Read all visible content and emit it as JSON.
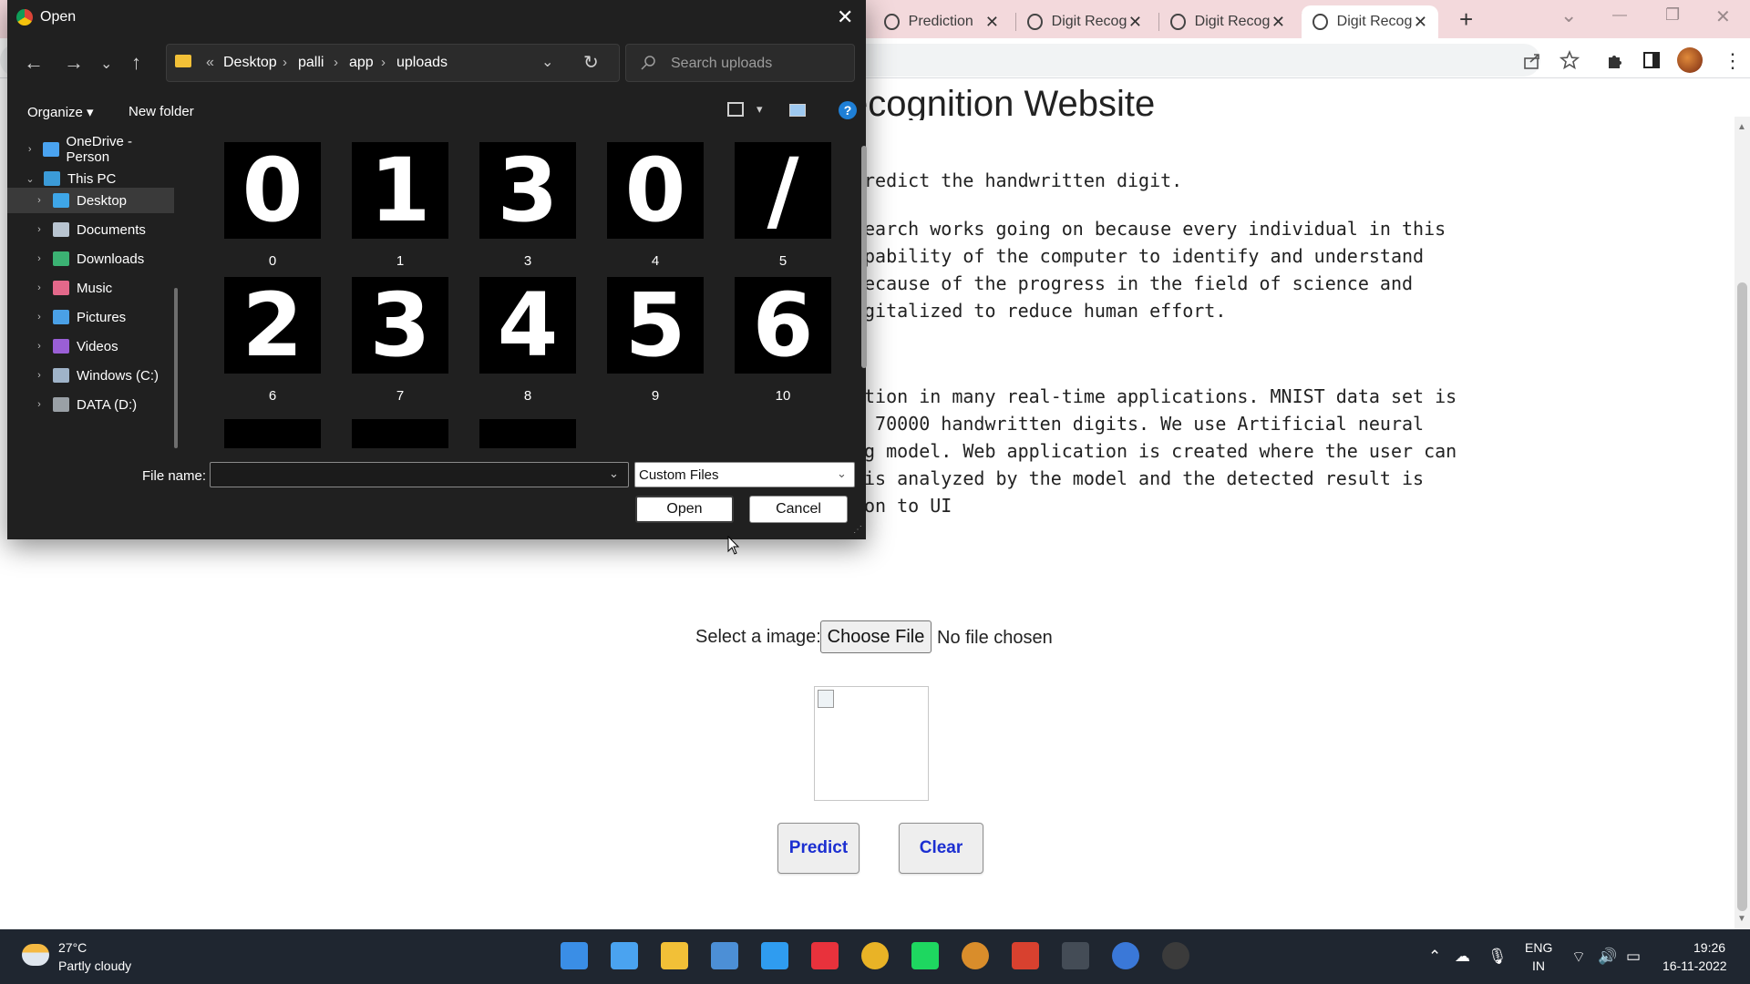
{
  "browser": {
    "tabs": [
      {
        "label": "Prediction",
        "active": false
      },
      {
        "label": "Digit Recog",
        "active": false
      },
      {
        "label": "Digit Recog",
        "active": false
      },
      {
        "label": "Digit Recog",
        "active": true
      }
    ],
    "new_tab_glyph": "+",
    "window_controls": {
      "minimize": "—",
      "maximize": "❐",
      "close": "✕",
      "dropdown": "⌄"
    },
    "toolbar_icons": [
      "share-icon",
      "star-icon",
      "extensions-icon",
      "sidepanel-icon",
      "profile-avatar",
      "menu-icon"
    ]
  },
  "page": {
    "heading": "ecognition Website",
    "intro": "redict the handwritten digit.",
    "paragraph1": [
      "earch works going on because every individual in this",
      "pability of the computer to identify and understand",
      "ecause of the progress in the field of science and",
      "gitalized to reduce human effort."
    ],
    "paragraph2": [
      "tion in many real-time applications. MNIST data set is",
      " 70000 handwritten digits. We use Artificial neural",
      "g model. Web application is created where the user can",
      "is analyzed by the model and the detected result is",
      "on to UI"
    ],
    "form": {
      "label": "Select a image:",
      "choose_file": "Choose File",
      "no_file": "No file chosen",
      "predict": "Predict",
      "clear": "Clear"
    }
  },
  "dialog": {
    "title": "Open",
    "close": "✕",
    "path": [
      "«",
      "Desktop",
      "palli",
      "app",
      "uploads"
    ],
    "search_placeholder": "Search uploads",
    "organize": "Organize ▾",
    "new_folder": "New folder",
    "nav_items": [
      {
        "label": "OneDrive - Person",
        "icon": "onedrive-icon",
        "color": "#4aa3f0",
        "indent": 0,
        "expand": "›",
        "selected": false
      },
      {
        "label": "This PC",
        "icon": "pc-icon",
        "color": "#3b9bd8",
        "indent": 0,
        "expand": "⌄",
        "selected": false
      },
      {
        "label": "Desktop",
        "icon": "desktop-icon",
        "color": "#3ea6e8",
        "indent": 1,
        "expand": "›",
        "selected": true
      },
      {
        "label": "Documents",
        "icon": "documents-icon",
        "color": "#b8c4d0",
        "indent": 1,
        "expand": "›",
        "selected": false
      },
      {
        "label": "Downloads",
        "icon": "downloads-icon",
        "color": "#3bb273",
        "indent": 1,
        "expand": "›",
        "selected": false
      },
      {
        "label": "Music",
        "icon": "music-icon",
        "color": "#e3688a",
        "indent": 1,
        "expand": "›",
        "selected": false
      },
      {
        "label": "Pictures",
        "icon": "pictures-icon",
        "color": "#4aa0e6",
        "indent": 1,
        "expand": "›",
        "selected": false
      },
      {
        "label": "Videos",
        "icon": "videos-icon",
        "color": "#9a5fd6",
        "indent": 1,
        "expand": "›",
        "selected": false
      },
      {
        "label": "Windows (C:)",
        "icon": "drive-icon",
        "color": "#9fb3c8",
        "indent": 1,
        "expand": "›",
        "selected": false
      },
      {
        "label": "DATA (D:)",
        "icon": "drive-icon",
        "color": "#9aa0a6",
        "indent": 1,
        "expand": "›",
        "selected": false
      }
    ],
    "files": [
      {
        "name": "0",
        "digit": "0"
      },
      {
        "name": "1",
        "digit": "1"
      },
      {
        "name": "3",
        "digit": "3"
      },
      {
        "name": "4",
        "digit": "0"
      },
      {
        "name": "5",
        "digit": "/"
      },
      {
        "name": "6",
        "digit": "2"
      },
      {
        "name": "7",
        "digit": "3"
      },
      {
        "name": "8",
        "digit": "4"
      },
      {
        "name": "9",
        "digit": "5"
      },
      {
        "name": "10",
        "digit": "6"
      }
    ],
    "file_name_label": "File name:",
    "file_name_value": "",
    "file_type": "Custom Files",
    "open_button": "Open",
    "cancel_button": "Cancel"
  },
  "taskbar": {
    "weather_temp": "27°C",
    "weather_desc": "Partly cloudy",
    "lang_line1": "ENG",
    "lang_line2": "IN",
    "time": "19:26",
    "date": "16-11-2022",
    "apps": [
      {
        "name": "start-icon",
        "color": "#3a8ee6"
      },
      {
        "name": "search-icon",
        "color": "#4aa3f0"
      },
      {
        "name": "file-explorer-icon",
        "color": "#f2c037"
      },
      {
        "name": "mail-icon",
        "color": "#4c8fd6"
      },
      {
        "name": "vscode-icon",
        "color": "#2f9cf0"
      },
      {
        "name": "app-red-icon",
        "color": "#e8323c"
      },
      {
        "name": "chrome-icon",
        "color": "#e9b326"
      },
      {
        "name": "spotify-icon",
        "color": "#1ed760"
      },
      {
        "name": "chrome-profile-icon",
        "color": "#d98d2b"
      },
      {
        "name": "office-icon",
        "color": "#d8412f"
      },
      {
        "name": "terminal-icon",
        "color": "#444c56"
      },
      {
        "name": "chrome-profile2-icon",
        "color": "#3a78d8"
      },
      {
        "name": "github-icon",
        "color": "#3b3b3b"
      }
    ]
  }
}
